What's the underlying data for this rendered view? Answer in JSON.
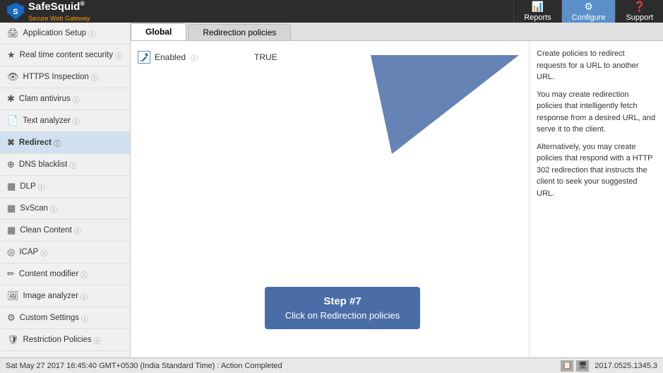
{
  "header": {
    "logo_name": "SafeSquid®",
    "logo_sub": "Secure Web Gateway",
    "nav": [
      {
        "id": "reports",
        "label": "Reports",
        "icon": "📊"
      },
      {
        "id": "configure",
        "label": "Configure",
        "icon": "⚙"
      },
      {
        "id": "support",
        "label": "Support",
        "icon": "❓"
      }
    ]
  },
  "sidebar": {
    "items": [
      {
        "id": "application-setup",
        "icon": "🖨",
        "label": "Application Setup",
        "has_help": true
      },
      {
        "id": "realtime-content",
        "icon": "★",
        "label": "Real time content security",
        "has_help": true
      },
      {
        "id": "https-inspection",
        "icon": "👁",
        "label": "HTTPS Inspection",
        "has_help": true
      },
      {
        "id": "clam-antivirus",
        "icon": "✱",
        "label": "Clam antivirus",
        "has_help": true
      },
      {
        "id": "text-analyzer",
        "icon": "📄",
        "label": "Text analyzer",
        "has_help": true
      },
      {
        "id": "redirect",
        "icon": "✖",
        "label": "Redirect",
        "has_help": true,
        "active": true
      },
      {
        "id": "dns-blacklist",
        "icon": "⊕",
        "label": "DNS blacklist",
        "has_help": true
      },
      {
        "id": "dlp",
        "icon": "▦",
        "label": "DLP",
        "has_help": true
      },
      {
        "id": "svscan",
        "icon": "▦",
        "label": "SvScan",
        "has_help": true
      },
      {
        "id": "clean-content",
        "icon": "▦",
        "label": "Clean Content",
        "has_help": true
      },
      {
        "id": "icap",
        "icon": "◎",
        "label": "ICAP",
        "has_help": true
      },
      {
        "id": "content-modifier",
        "icon": "✏",
        "label": "Content modifier",
        "has_help": true
      },
      {
        "id": "image-analyzer",
        "icon": "🖼",
        "label": "Image analyzer",
        "has_help": true
      },
      {
        "id": "custom-settings",
        "icon": "⚙",
        "label": "Custom Settings",
        "has_help": true
      },
      {
        "id": "restriction-policies",
        "icon": "🛡",
        "label": "Restriction Policies",
        "has_help": true
      }
    ]
  },
  "tabs": [
    {
      "id": "global",
      "label": "Global",
      "active": true
    },
    {
      "id": "redirection-policies",
      "label": "Redirection policies",
      "active": false
    }
  ],
  "main": {
    "enabled_label": "Enabled",
    "enabled_value": "TRUE",
    "redirection_link": "Redirection policies"
  },
  "right_panel": {
    "paragraphs": [
      "Create policies to redirect requests for a URL to another URL.",
      "You may create redirection policies that intelligently fetch response from a desired URL, and serve it to the client.",
      "Alternatively, you may create policies that respond with a HTTP 302 redirection that instructs the client to seek your suggested URL."
    ]
  },
  "step_tooltip": {
    "step_num": "Step #7",
    "description": "Click on Redirection policies"
  },
  "footer": {
    "status": "Sat May 27 2017 16:45:40 GMT+0530 (India Standard Time) : Action Completed",
    "version": "2017.0525.1345.3"
  }
}
